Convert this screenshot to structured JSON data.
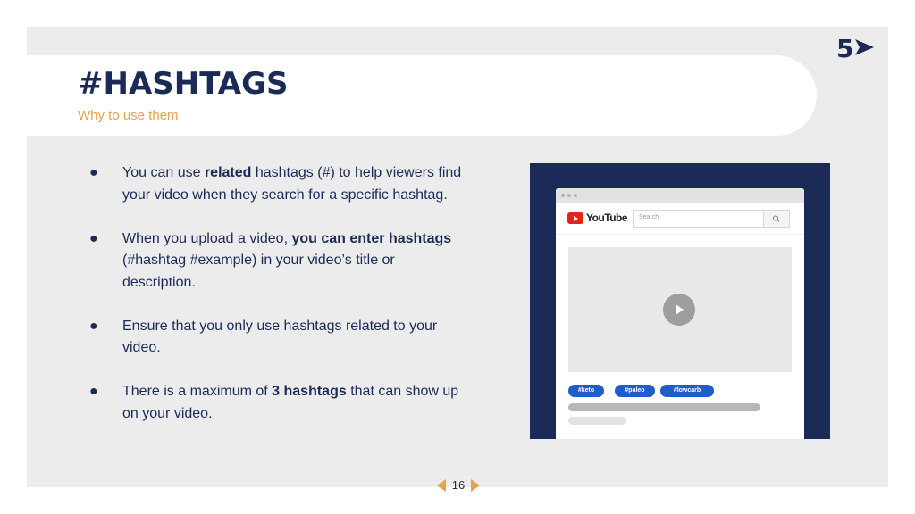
{
  "slide": {
    "title": "#HASHTAGS",
    "subtitle": "Why to use them",
    "page_number": "16",
    "logo_text": "5",
    "colors": {
      "navy": "#1b2a57",
      "accent": "#e8a24a",
      "background": "#ececec"
    }
  },
  "bullets": [
    {
      "parts": [
        {
          "text": "You can use "
        },
        {
          "text": "related",
          "bold": true
        },
        {
          "text": " hashtags (#) to help viewers find your video when they search for a specific hashtag."
        }
      ]
    },
    {
      "parts": [
        {
          "text": "When you upload a video, "
        },
        {
          "text": "you can enter hashtags",
          "bold": true
        },
        {
          "text": " (#hashtag #example) in your video’s title or description."
        }
      ]
    },
    {
      "parts": [
        {
          "text": "Ensure that you only use hashtags related to your video."
        }
      ]
    },
    {
      "parts": [
        {
          "text": "There is a maximum of "
        },
        {
          "text": "3 hashtags",
          "bold": true
        },
        {
          "text": " that can show up on your video."
        }
      ]
    }
  ],
  "mockup": {
    "brand": "YouTube",
    "search_placeholder": "Search",
    "tags": [
      "#keto",
      "#paleo",
      "#lowcarb"
    ],
    "icons": {
      "search": "search-icon",
      "play": "play-icon"
    }
  }
}
